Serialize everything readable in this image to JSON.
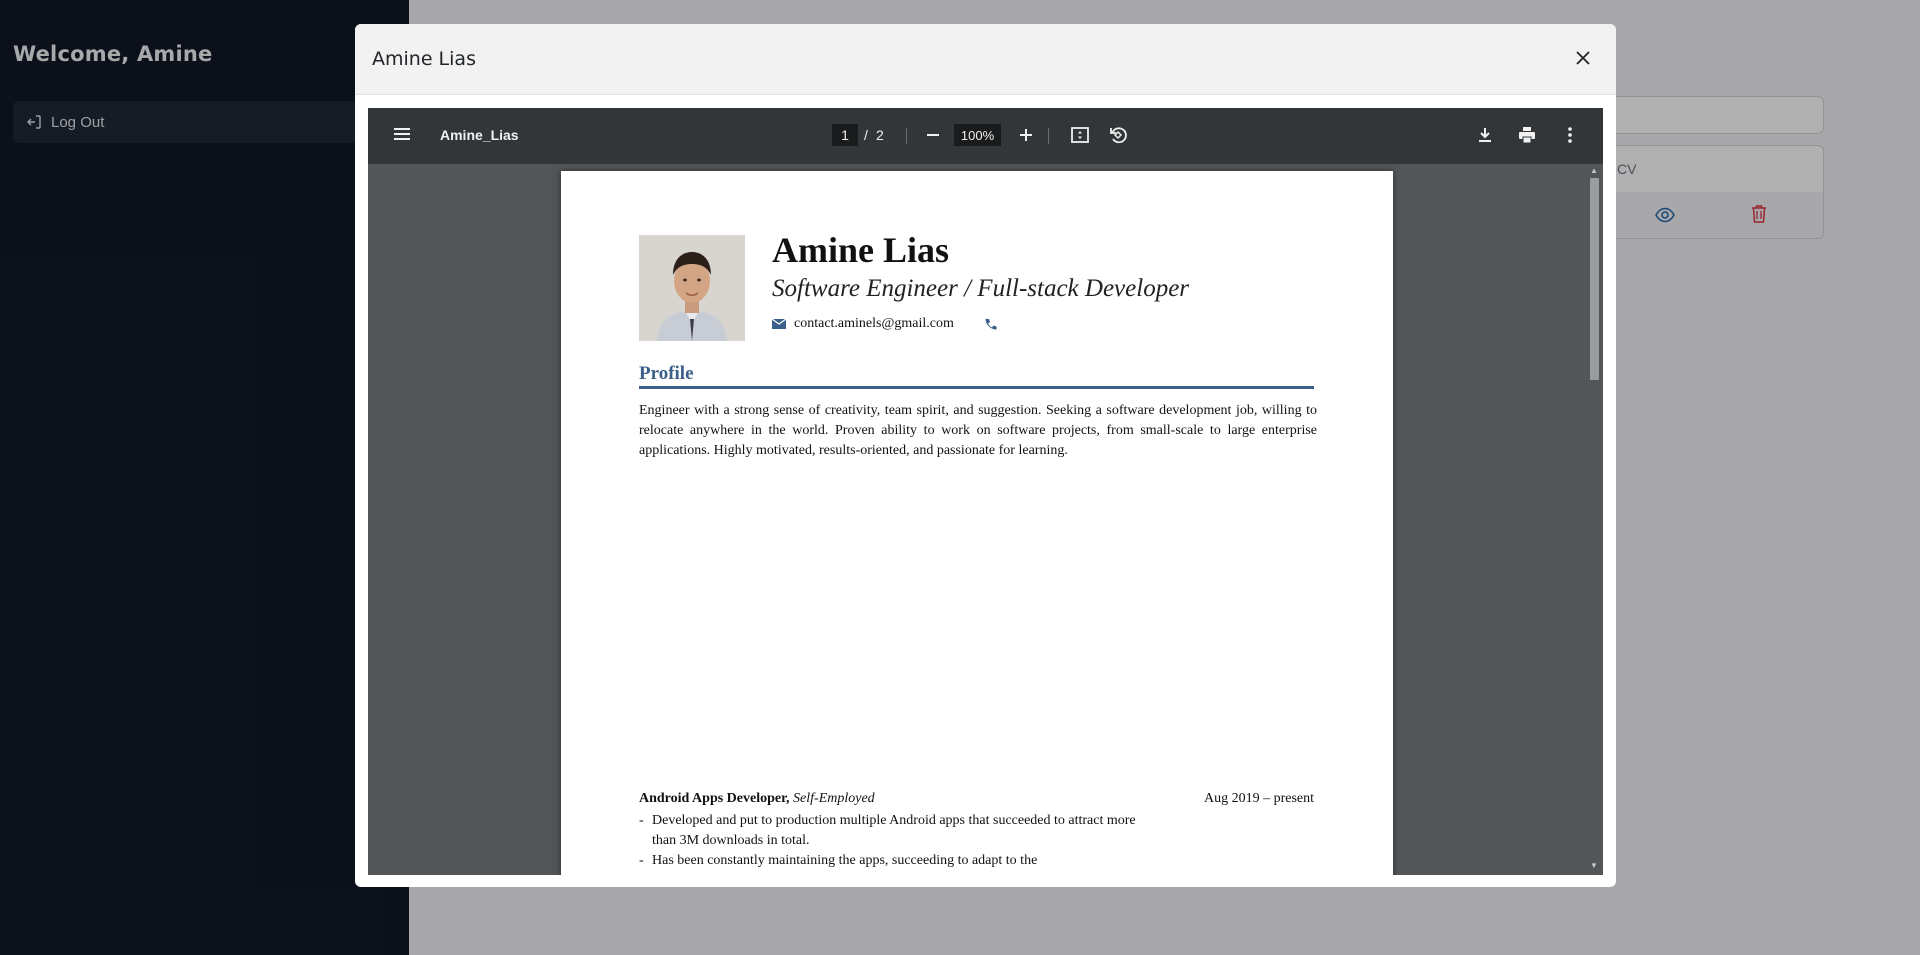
{
  "sidebar": {
    "welcome": "Welcome, Amine",
    "logout_label": "Log Out"
  },
  "background_table": {
    "column_cv": "CV"
  },
  "modal": {
    "title": "Amine Lias"
  },
  "pdf_viewer": {
    "file_name": "Amine_Lias",
    "current_page": "1",
    "page_separator": "/",
    "total_pages": "2",
    "zoom": "100%"
  },
  "cv": {
    "name": "Amine Lias",
    "role": "Software Engineer / Full-stack Developer",
    "email": "contact.aminels@gmail.com",
    "profile_heading": "Profile",
    "profile_text": "Engineer with a strong sense of creativity, team spirit, and suggestion. Seeking a software development job, willing to relocate anywhere in the world. Proven ability to work on software projects, from small-scale to large enterprise applications. Highly motivated, results-oriented, and passionate for learning.",
    "job": {
      "title": "Android Apps Developer,",
      "company": "Self-Employed",
      "date": "Aug 2019 – present",
      "bullets": [
        "Developed and put to production multiple Android apps that succeeded to attract more than 3M downloads in total.",
        "Has been constantly maintaining the apps, succeeding to adapt to the"
      ]
    }
  },
  "colors": {
    "sidebar_bg": "#111827",
    "accent": "#3b5f8a",
    "delete_red": "#dc3545",
    "view_blue": "#2b6cb0"
  }
}
